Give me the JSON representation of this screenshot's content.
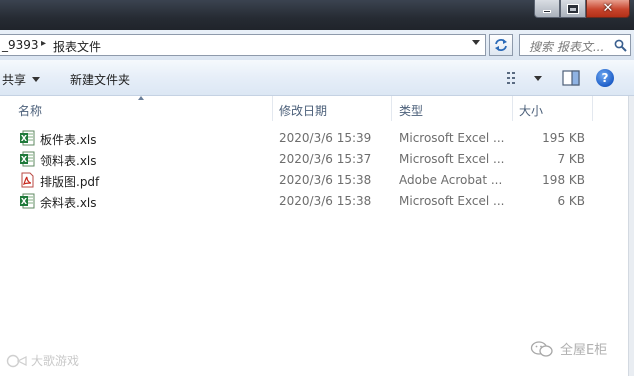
{
  "address": {
    "crumb_partial": "_9393",
    "crumb_current": "报表文件",
    "search_placeholder": "搜索 报表文..."
  },
  "toolbar": {
    "share_label": "共享",
    "new_folder_label": "新建文件夹"
  },
  "columns": {
    "name": "名称",
    "date": "修改日期",
    "type": "类型",
    "size": "大小"
  },
  "files": [
    {
      "name": "板件表.xls",
      "date": "2020/3/6 15:39",
      "type": "Microsoft Excel ...",
      "size": "195 KB",
      "icon": "excel-file-icon"
    },
    {
      "name": "领料表.xls",
      "date": "2020/3/6 15:37",
      "type": "Microsoft Excel ...",
      "size": "7 KB",
      "icon": "excel-file-icon"
    },
    {
      "name": "排版图.pdf",
      "date": "2020/3/6 15:38",
      "type": "Adobe Acrobat ...",
      "size": "198 KB",
      "icon": "pdf-file-icon"
    },
    {
      "name": "余料表.xls",
      "date": "2020/3/6 15:38",
      "type": "Microsoft Excel ...",
      "size": "6 KB",
      "icon": "excel-file-icon"
    }
  ],
  "watermarks": {
    "left": "大歌游戏",
    "right": "全屋E柜"
  },
  "colors": {
    "titlebar": "#262b33",
    "close_button": "#c8452d",
    "header_text": "#4c607a",
    "excel_green": "#1f7a3a",
    "pdf_red": "#c8281e"
  }
}
